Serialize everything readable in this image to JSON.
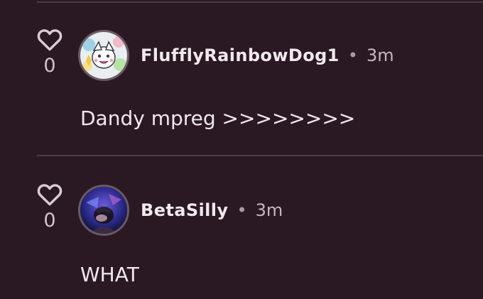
{
  "comments": [
    {
      "like_count": "0",
      "username": "FlufflyRainbowDog1",
      "separator": "•",
      "time": "3m",
      "text": "Dandy mpreg >>>>>>>>"
    },
    {
      "like_count": "0",
      "username": "BetaSilly",
      "separator": "•",
      "time": "3m",
      "text": "WHAT"
    }
  ],
  "colors": {
    "background": "#2a1922",
    "divider": "#4b3a43",
    "text": "#f1e8ec"
  }
}
